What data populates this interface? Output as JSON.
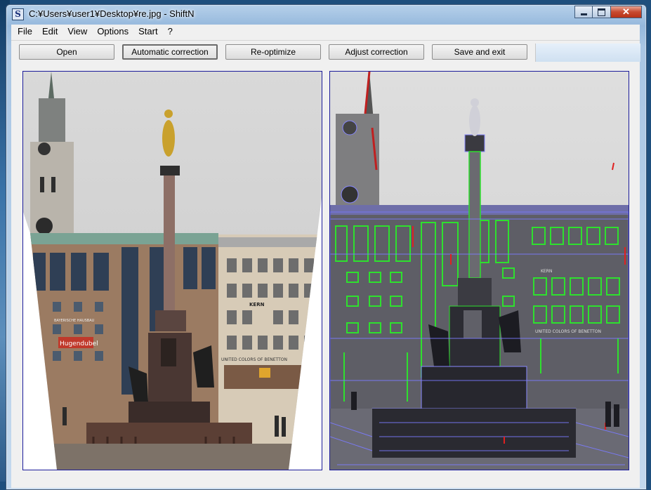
{
  "window": {
    "title": "C:¥Users¥user1¥Desktop¥re.jpg - ShiftN",
    "app_icon_letter": "S",
    "close_symbol": "✕"
  },
  "menu": {
    "items": [
      "File",
      "Edit",
      "View",
      "Options",
      "Start",
      "?"
    ]
  },
  "toolbar": {
    "buttons": [
      "Open",
      "Automatic correction",
      "Re-optimize",
      "Adjust correction",
      "Save and exit"
    ],
    "active_button": "Automatic correction"
  },
  "panels": {
    "left": {
      "content": "corrected photo of a column statue in a city square"
    },
    "right": {
      "content": "edge-detected image with blue, green and red line overlays"
    }
  },
  "image_signs": {
    "store_left": "BAYERISCHE HAUSBAU",
    "store_left_logo": "Hugendubel",
    "store_right_logo": "KERN",
    "store_right_banner": "UNITED COLORS OF BENETTON"
  }
}
